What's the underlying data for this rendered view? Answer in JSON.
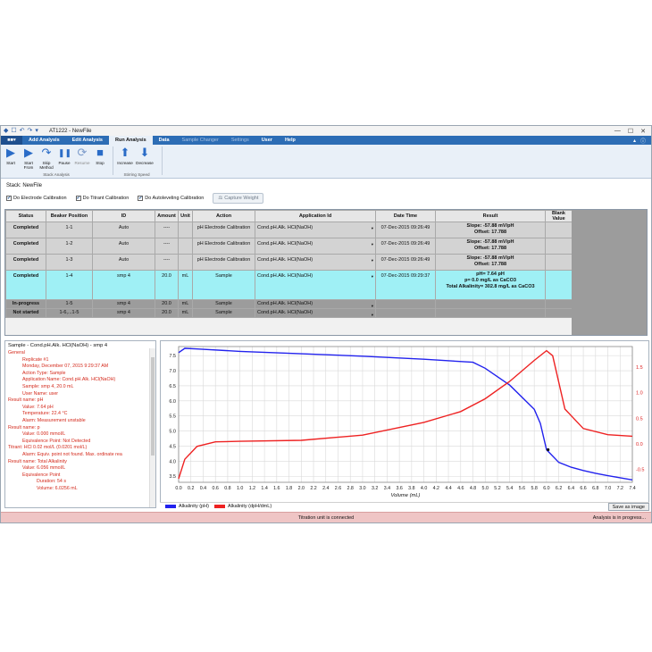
{
  "window": {
    "title": "AT1222 - NewFile",
    "quick_access": [
      "◆",
      "☐",
      "↶",
      "↷",
      "▾"
    ],
    "controls": [
      "—",
      "☐",
      "✕"
    ]
  },
  "ribbon": {
    "file_tab": "■■▾",
    "tabs": [
      {
        "label": "Add Analysis",
        "state": "normal"
      },
      {
        "label": "Edit Analysis",
        "state": "normal"
      },
      {
        "label": "Run Analysis",
        "state": "active"
      },
      {
        "label": "Data",
        "state": "normal"
      },
      {
        "label": "Sample Changer",
        "state": "disabled"
      },
      {
        "label": "Settings",
        "state": "disabled"
      },
      {
        "label": "User",
        "state": "normal"
      },
      {
        "label": "Help",
        "state": "normal"
      }
    ],
    "help_icons": [
      "▴",
      "ⓘ"
    ],
    "stack_buttons": [
      {
        "label": "Start",
        "icon": "play-icon",
        "glyph": "▶"
      },
      {
        "label": "Start From",
        "icon": "play-from-icon",
        "glyph": "▶"
      },
      {
        "label": "Skip Method",
        "icon": "skip-icon",
        "glyph": "↷"
      },
      {
        "label": "Pause",
        "icon": "pause-icon",
        "glyph": "❚❚"
      },
      {
        "label": "Resume",
        "icon": "resume-icon",
        "glyph": "⟳"
      },
      {
        "label": "Stop",
        "icon": "stop-icon",
        "glyph": "■"
      }
    ],
    "stack_group_label": "Stack Analysis",
    "stirring_buttons": [
      {
        "label": "Increase",
        "icon": "arrow-up-icon",
        "glyph": "⬆"
      },
      {
        "label": "Decrease",
        "icon": "arrow-down-icon",
        "glyph": "⬇"
      }
    ],
    "stirring_group_label": "Stirring Speed"
  },
  "stack": {
    "title": "Stack: NewFile",
    "checkboxes": [
      {
        "label": "Do Electrode Calibration",
        "checked": true
      },
      {
        "label": "Do Titrant Calibration",
        "checked": true
      },
      {
        "label": "Do Autoleveling Calibration",
        "checked": true
      }
    ],
    "capture_button": "Capture Weight"
  },
  "table": {
    "headers": [
      "Status",
      "Beaker Position",
      "ID",
      "Amount",
      "Unit",
      "Action",
      "Application Id",
      "Date Time",
      "Result",
      "Blank Value"
    ],
    "rows": [
      {
        "kind": "done",
        "status": "Completed",
        "position": "1-1",
        "id": "Auto",
        "amount": "----",
        "unit": "",
        "action": "pH Electrode Calibration",
        "app_id": "Cond.pH.Alk. HCl(NaOH)",
        "datetime": "07-Dec-2015 09:26:49",
        "result": [
          "Slope: -57.88 mV/pH",
          "Offset: 17.788"
        ],
        "blank": ""
      },
      {
        "kind": "done",
        "status": "Completed",
        "position": "1-2",
        "id": "Auto",
        "amount": "----",
        "unit": "",
        "action": "pH Electrode Calibration",
        "app_id": "Cond.pH.Alk. HCl(NaOH)",
        "datetime": "07-Dec-2015 09:26:49",
        "result": [
          "Slope: -57.88 mV/pH",
          "Offset: 17.788"
        ],
        "blank": ""
      },
      {
        "kind": "done",
        "status": "Completed",
        "position": "1-3",
        "id": "Auto",
        "amount": "----",
        "unit": "",
        "action": "pH Electrode Calibration",
        "app_id": "Cond.pH.Alk. HCl(NaOH)",
        "datetime": "07-Dec-2015 09:26:49",
        "result": [
          "Slope: -57.88 mV/pH",
          "Offset: 17.788"
        ],
        "blank": ""
      },
      {
        "kind": "sel",
        "status": "Completed",
        "position": "1-4",
        "id": "smp 4",
        "amount": "20.0",
        "unit": "mL",
        "action": "Sample",
        "app_id": "Cond.pH.Alk. HCl(NaOH)",
        "datetime": "07-Dec-2015 09:29:37",
        "result": [
          "pH= 7.64 pH",
          "p= 0.0 mg/L as CaCO3",
          "Total Alkalinity= 302.8 mg/L as CaCO3"
        ],
        "blank": ""
      },
      {
        "kind": "pend",
        "status": "In-progress",
        "position": "1-5",
        "id": "smp 4",
        "amount": "20.0",
        "unit": "mL",
        "action": "Sample",
        "app_id": "Cond.pH.Alk. HCl(NaOH)",
        "datetime": "",
        "result": [
          ""
        ],
        "blank": ""
      },
      {
        "kind": "pend",
        "status": "Not started",
        "position": "1-6,...1-5",
        "id": "smp 4",
        "amount": "20.0",
        "unit": "mL",
        "action": "Sample",
        "app_id": "Cond.pH.Alk. HCl(NaOH)",
        "datetime": "",
        "result": [
          ""
        ],
        "blank": ""
      }
    ]
  },
  "details": {
    "title": "Sample - Cond.pH.Alk. HCl(NaOH) - smp 4",
    "lines": [
      {
        "text": "General",
        "indent": 0
      },
      {
        "text": "Replicate #1",
        "indent": 2
      },
      {
        "text": "Monday, December 07, 2015 9:29:37 AM",
        "indent": 2
      },
      {
        "text": "Action Type: Sample",
        "indent": 2
      },
      {
        "text": "Application Name: Cond.pH.Alk. HCl(NaOH)",
        "indent": 2
      },
      {
        "text": "Sample: smp 4, 20.0 mL",
        "indent": 2
      },
      {
        "text": "User Name: user",
        "indent": 2
      },
      {
        "text": "Result name: pH",
        "indent": 0
      },
      {
        "text": "Value: 7.64 pH",
        "indent": 2
      },
      {
        "text": "Temperature: 22.4 °C",
        "indent": 2
      },
      {
        "text": "Alarm: Measurement unstable",
        "indent": 2
      },
      {
        "text": "Result name: p",
        "indent": 0
      },
      {
        "text": "Value: 0.000 mmol/L",
        "indent": 2
      },
      {
        "text": "Equivalence Point: Not Detected",
        "indent": 2
      },
      {
        "text": "Titrant: HCl 0.02 mol/L (0.0201 mol/L)",
        "indent": 0
      },
      {
        "text": "Alarm: Equiv. point not found. Max. ordinate rea",
        "indent": 2
      },
      {
        "text": "Result name: Total Alkalinity",
        "indent": 0
      },
      {
        "text": "Value: 6.056 mmol/L",
        "indent": 2
      },
      {
        "text": "Equivalence Point",
        "indent": 2
      },
      {
        "text": "Duration: 54 s",
        "indent": 4
      },
      {
        "text": "Volume: 6.0256 mL",
        "indent": 4
      }
    ]
  },
  "chart_data": {
    "type": "line",
    "title": "",
    "xlabel": "Volume (mL)",
    "ylabel": "",
    "xlim": [
      0.0,
      7.4
    ],
    "ylim_left": [
      3.3,
      7.8
    ],
    "ylim_right": [
      -0.75,
      1.9
    ],
    "x_ticks": [
      "0.0",
      "0.2",
      "0.4",
      "0.6",
      "0.8",
      "1.0",
      "1.2",
      "1.4",
      "1.6",
      "1.8",
      "2.0",
      "2.2",
      "2.4",
      "2.6",
      "2.8",
      "3.0",
      "3.2",
      "3.4",
      "3.6",
      "3.8",
      "4.0",
      "4.2",
      "4.4",
      "4.6",
      "4.8",
      "5.0",
      "5.2",
      "5.4",
      "5.6",
      "5.8",
      "6.0",
      "6.2",
      "6.4",
      "6.6",
      "6.8",
      "7.0",
      "7.2",
      "7.4"
    ],
    "y_left_ticks": [
      "3.5",
      "4.0",
      "4.5",
      "5.0",
      "5.5",
      "6.0",
      "6.5",
      "7.0",
      "7.5"
    ],
    "y_right_ticks": [
      "-0.5",
      "0.0",
      "0.5",
      "1.0",
      "1.5"
    ],
    "grid": true,
    "legend": "bottom-left",
    "series": [
      {
        "name": "Alkalinity (pH)",
        "axis": "left",
        "color": "#2222ee",
        "x": [
          0.0,
          0.1,
          0.3,
          1.0,
          2.0,
          3.0,
          4.0,
          4.8,
          5.0,
          5.4,
          5.8,
          5.9,
          6.0,
          6.2,
          6.4,
          6.6,
          6.8,
          7.0,
          7.2,
          7.4
        ],
        "y": [
          7.6,
          7.74,
          7.72,
          7.64,
          7.56,
          7.48,
          7.38,
          7.28,
          7.08,
          6.52,
          5.72,
          5.25,
          4.38,
          3.96,
          3.8,
          3.69,
          3.6,
          3.52,
          3.45,
          3.38
        ]
      },
      {
        "name": "Alkalinity (dpH/dmL)",
        "axis": "right",
        "color": "#ee2222",
        "x": [
          0.0,
          0.1,
          0.3,
          0.6,
          1.0,
          2.0,
          3.0,
          4.0,
          4.6,
          5.0,
          5.4,
          5.8,
          6.0,
          6.1,
          6.3,
          6.6,
          7.0,
          7.4
        ],
        "y": [
          -0.68,
          -0.3,
          -0.05,
          0.04,
          0.05,
          0.07,
          0.17,
          0.42,
          0.63,
          0.88,
          1.22,
          1.63,
          1.82,
          1.72,
          0.68,
          0.3,
          0.18,
          0.15
        ]
      }
    ]
  },
  "save_image": "Save as image",
  "statusbar": {
    "center": "Titration unit is connected",
    "right": "Analysis is in progress..."
  }
}
